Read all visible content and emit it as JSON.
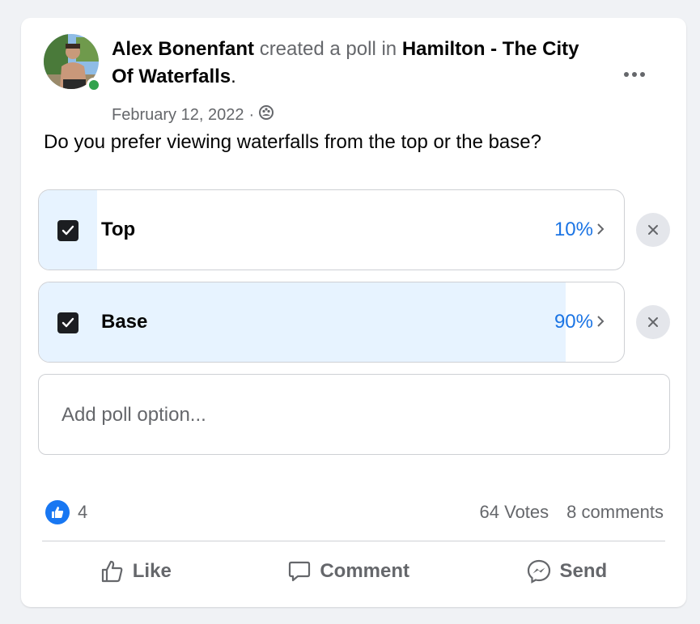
{
  "post": {
    "author": "Alex Bonenfant",
    "action_text": "created a poll in",
    "group": "Hamilton - The City Of Waterfalls",
    "trailing": ".",
    "date": "February 12, 2022",
    "separator": "·",
    "privacy_icon": "group-icon",
    "question": "Do you prefer viewing waterfalls from the top or the base?"
  },
  "poll": {
    "options": [
      {
        "label": "Top",
        "percent_text": "10%",
        "percent": 10,
        "checked": true
      },
      {
        "label": "Base",
        "percent_text": "90%",
        "percent": 90,
        "checked": true
      }
    ],
    "add_option_placeholder": "Add poll option..."
  },
  "stats": {
    "reaction_count": "4",
    "votes": "64 Votes",
    "comments": "8 comments"
  },
  "actions": {
    "like": "Like",
    "comment": "Comment",
    "send": "Send"
  },
  "colors": {
    "accent": "#1b74e4",
    "fill": "#e7f3ff",
    "online": "#31a24c"
  }
}
